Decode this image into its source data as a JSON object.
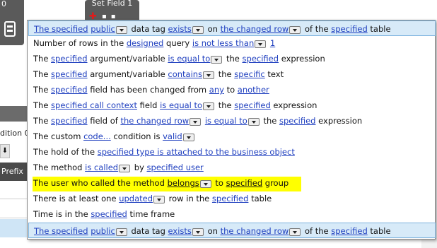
{
  "background": {
    "node_left_title": "0",
    "node_setfield_title": "Set Field 1",
    "left_condition_label": "dition 0",
    "left_arrow": "⬇",
    "prefix_header": "Prefix"
  },
  "dropdown": {
    "header": {
      "w1": "The specified",
      "w2": "public",
      "w3": "data tag",
      "w4": "exists",
      "w5": "on",
      "w6": "the changed row",
      "w7": "of the",
      "w8": "specified",
      "w9": "table"
    },
    "items": [
      {
        "t1": "Number of rows in the",
        "l1": "designed",
        "t2": "query",
        "l2": "is not less than",
        "l3": "1"
      },
      {
        "t1": "The",
        "l1": "specified",
        "t2": "argument/variable",
        "l2": "is equal to",
        "t3": "the",
        "l3": "specified",
        "t4": "expression"
      },
      {
        "t1": "The",
        "l1": "specified",
        "t2": "argument/variable",
        "l2": "contains",
        "t3": "the",
        "l3": "specific",
        "t4": "text"
      },
      {
        "t1": "The",
        "l1": "specified",
        "t2": "field has been changed from",
        "l2": "any",
        "t3": "to",
        "l3": "another"
      },
      {
        "t1": "The",
        "l1": "specified call context",
        "t2": "field",
        "l2": "is equal to",
        "t3": "the",
        "l3": "specified",
        "t4": "expression"
      },
      {
        "t1": "The",
        "l1": "specified",
        "t2": "field of",
        "l2": "the changed row",
        "l3": "is equal to",
        "t3": "the",
        "l4": "specified",
        "t4": "expression"
      },
      {
        "t1": "The custom",
        "l1": "code...",
        "t2": "condition is",
        "l2": "valid"
      },
      {
        "t1": "The hold of the",
        "l1": "specified type is attached to the business object"
      },
      {
        "t1": "The method",
        "l1": "is called",
        "t2": "by",
        "l2": "specified user"
      },
      {
        "t1": "The user who called the method",
        "l1": "belongs",
        "t2": "to",
        "l2": "specified",
        "t3": "group"
      },
      {
        "t1": "There is at least one",
        "l1": "updated",
        "t2": "row in the",
        "l2": "specified",
        "t3": "table"
      },
      {
        "t1": "Time is in the",
        "l1": "specified",
        "t2": "time frame"
      }
    ],
    "footer": {
      "w1": "The specified",
      "w2": "public",
      "w3": "data tag",
      "w4": "exists",
      "w5": "on",
      "w6": "the changed row",
      "w7": "of the",
      "w8": "specified",
      "w9": "table"
    },
    "highlight_color": "#ffff00",
    "link_color": "#1f3fbf",
    "header_bg": "#d7eaf8"
  }
}
